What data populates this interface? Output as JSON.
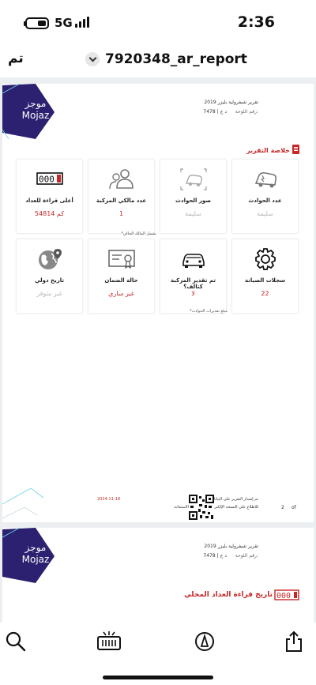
{
  "status_bar": {
    "network": "5G",
    "time": "2:36"
  },
  "nav": {
    "done_label": "تم",
    "document_title": "7920348_ar_report"
  },
  "report": {
    "logo_ar": "موجز",
    "logo_en": "Mojaz",
    "vehicle_heading": "تقرير شيفرولية بليزر 2019",
    "plate_label": "رقم اللوحة:",
    "plate_value": "د ج | 7478",
    "summary_title": "خلاصة التقرير",
    "cards": [
      {
        "label": "عدد الحوادث",
        "value": "سليمة",
        "muted": true,
        "icon": "crashed-car-icon"
      },
      {
        "label": "صور الحوادث",
        "value": "سليمة",
        "muted": true,
        "icon": "accident-photo-icon"
      },
      {
        "label": "عدد مالكي المركبة",
        "value": "1",
        "muted": false,
        "icon": "owners-icon"
      },
      {
        "label": "أعلى قراءة للعداد",
        "value": "54814 كم",
        "muted": false,
        "icon": "odometer-icon"
      },
      {
        "label": "سجلات الصيانة",
        "value": "22",
        "muted": false,
        "icon": "gear-icon"
      },
      {
        "label": "تم تقدير المركبة كتالف؟",
        "value": "لا",
        "muted": false,
        "icon": "car-icon"
      },
      {
        "label": "حالة الضمان",
        "value": "غير ساري",
        "muted": false,
        "icon": "warranty-certificate-icon"
      },
      {
        "label": "تاريخ دولي",
        "value": "غير متوفر",
        "muted": true,
        "icon": "globe-location-icon"
      }
    ],
    "note_owner": "*يشمل المالك الحالي",
    "note_accidents": "*مبلغ تقديرات الحوادث",
    "footer_issue": "تم إصدار التقرير على البيانات المتاحة",
    "footer_date": "2024-11-18",
    "footer_verify": "للاطلاع على النسخة الإلكترونية امسح رمز الاستجابة",
    "page_number": "2",
    "page_of": "of"
  },
  "page2": {
    "vehicle_heading": "تقرير شيفرولية بليزر 2019",
    "plate_label": "رقم اللوحة:",
    "plate_value": "د ج | 7478",
    "section_title": "تاريخ قراءة العداد المحلي",
    "odometer_icon_digits": "000"
  },
  "colors": {
    "accent": "#c62828",
    "brand": "#2b2170",
    "muted": "#b8b8b8"
  }
}
